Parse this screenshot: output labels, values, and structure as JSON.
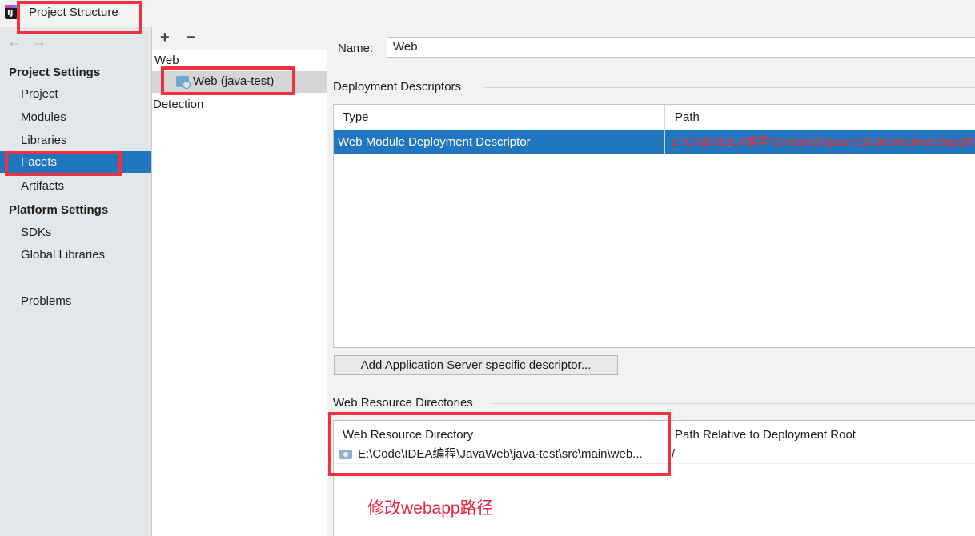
{
  "window": {
    "title": "Project Structure"
  },
  "nav": {
    "back": "←",
    "forward": "→",
    "project_settings": "Project Settings",
    "project": "Project",
    "modules": "Modules",
    "libraries": "Libraries",
    "facets": "Facets",
    "artifacts": "Artifacts",
    "platform_settings": "Platform Settings",
    "sdks": "SDKs",
    "global_libraries": "Global Libraries",
    "problems": "Problems"
  },
  "middle": {
    "add": "+",
    "remove": "−",
    "tree_web": "Web",
    "tree_facet": "Web (java-test)",
    "tree_detection": "Detection"
  },
  "details": {
    "name_label": "Name:",
    "name_value": "Web",
    "dd_group": "Deployment Descriptors",
    "dd_columns": [
      "Type",
      "Path"
    ],
    "dd_rows": [
      {
        "type": "Web Module Deployment Descriptor",
        "path": "E:\\Code\\IDEA编程\\JavaWeb\\java-test\\src\\main\\webapp\\WEB-INF\\web.xml"
      }
    ],
    "add_button": "Add Application Server specific descriptor...",
    "wr_group": "Web Resource Directories",
    "wr_columns": [
      "Web Resource Directory",
      "Path Relative to Deployment Root"
    ],
    "wr_rows": [
      {
        "dir": "E:\\Code\\IDEA编程\\JavaWeb\\java-test\\src\\main\\web...",
        "relative": "/"
      }
    ]
  },
  "annotation": "修改webapp路径",
  "colors": {
    "selection": "#2176c0",
    "highlight": "#f0313f",
    "path_text": "#ff2a2a"
  }
}
